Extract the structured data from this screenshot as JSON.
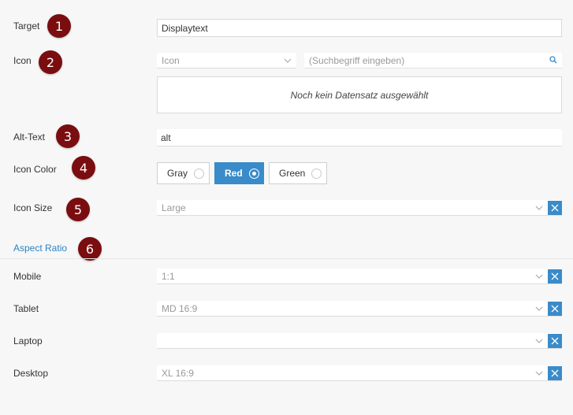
{
  "fields": {
    "target": {
      "label": "Target",
      "value": "Displaytext",
      "badge": "1"
    },
    "icon": {
      "label": "Icon",
      "badge": "2",
      "select_value": "Icon",
      "search_placeholder": "(Suchbegriff eingeben)",
      "empty_text": "Noch kein Datensatz ausgewählt"
    },
    "alt_text": {
      "label": "Alt-Text",
      "value": "alt",
      "badge": "3"
    },
    "icon_color": {
      "label": "Icon Color",
      "badge": "4",
      "options": [
        "Gray",
        "Red",
        "Green"
      ],
      "selected": "Red"
    },
    "icon_size": {
      "label": "Icon Size",
      "value": "Large",
      "badge": "5"
    }
  },
  "aspect_ratio": {
    "title": "Aspect Ratio",
    "badge": "6",
    "mobile": {
      "label": "Mobile",
      "value": "1:1"
    },
    "tablet": {
      "label": "Tablet",
      "value": "MD 16:9"
    },
    "laptop": {
      "label": "Laptop",
      "value": ""
    },
    "desktop": {
      "label": "Desktop",
      "value": "XL 16:9"
    }
  },
  "colors": {
    "accent": "#3a8bc9",
    "badge": "#7a0d10",
    "section_title": "#2a84c6"
  },
  "icons": {
    "chevron": "chevron-down-icon",
    "clear": "close-icon",
    "search": "search-icon"
  }
}
